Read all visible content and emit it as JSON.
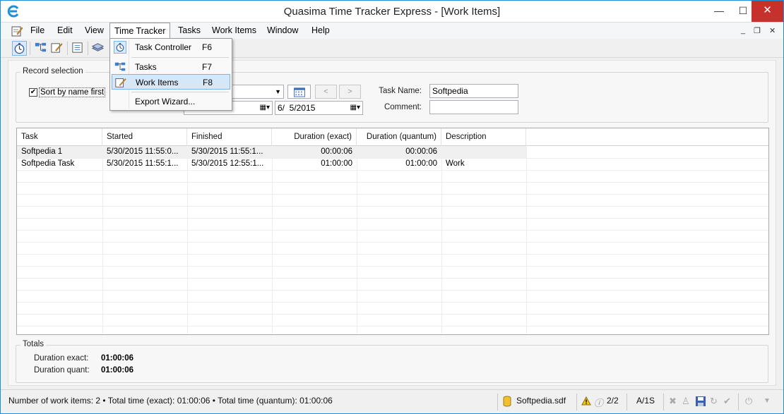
{
  "window": {
    "title": "Quasima Time Tracker Express - [Work Items]",
    "minimize": "—",
    "maximize": "☐",
    "close": "✕"
  },
  "menubar": {
    "items": [
      "File",
      "Edit",
      "View",
      "Time Tracker",
      "Tasks",
      "Work Items",
      "Window",
      "Help"
    ],
    "mdi_min": "_",
    "mdi_restore": "❐",
    "mdi_close": "✕"
  },
  "dropdown": {
    "items": [
      {
        "label": "Task Controller",
        "shortcut": "F6",
        "icon": "stopwatch-icon"
      },
      {
        "label": "Tasks",
        "shortcut": "F7",
        "icon": "task-tree-icon"
      },
      {
        "label": "Work Items",
        "shortcut": "F8",
        "icon": "edit-icon"
      },
      {
        "label": "Export Wizard...",
        "shortcut": "",
        "icon": ""
      }
    ]
  },
  "record_selection": {
    "title": "Record selection",
    "sort_label": "Sort by name first",
    "sort_checked": true,
    "date_to": "6/  5/2015",
    "prev": "<",
    "next": ">",
    "task_name_label": "Task Name:",
    "task_name_value": "Softpedia",
    "comment_label": "Comment:",
    "comment_value": ""
  },
  "grid": {
    "columns": [
      "Task",
      "Started",
      "Finished",
      "Duration (exact)",
      "Duration (quantum)",
      "Description"
    ],
    "rows": [
      [
        "Softpedia 1",
        "5/30/2015 11:55:0...",
        "5/30/2015 11:55:1...",
        "00:00:06",
        "00:00:06",
        ""
      ],
      [
        "Softpedia Task",
        "5/30/2015 11:55:1...",
        "5/30/2015 12:55:1...",
        "01:00:00",
        "01:00:00",
        "Work"
      ]
    ]
  },
  "totals": {
    "title": "Totals",
    "exact_label": "Duration exact:",
    "exact_value": "01:00:06",
    "quant_label": "Duration quant:",
    "quant_value": "01:00:06"
  },
  "status": {
    "summary": "Number of work items: 2 • Total time (exact): 01:00:06 • Total time (quantum): 01:00:06",
    "database": "Softpedia.sdf",
    "page": "2/2",
    "mode": "A/1S"
  },
  "colors": {
    "accent": "#1e90d8",
    "close_red": "#c7312b",
    "highlight": "#d6e8f8"
  }
}
